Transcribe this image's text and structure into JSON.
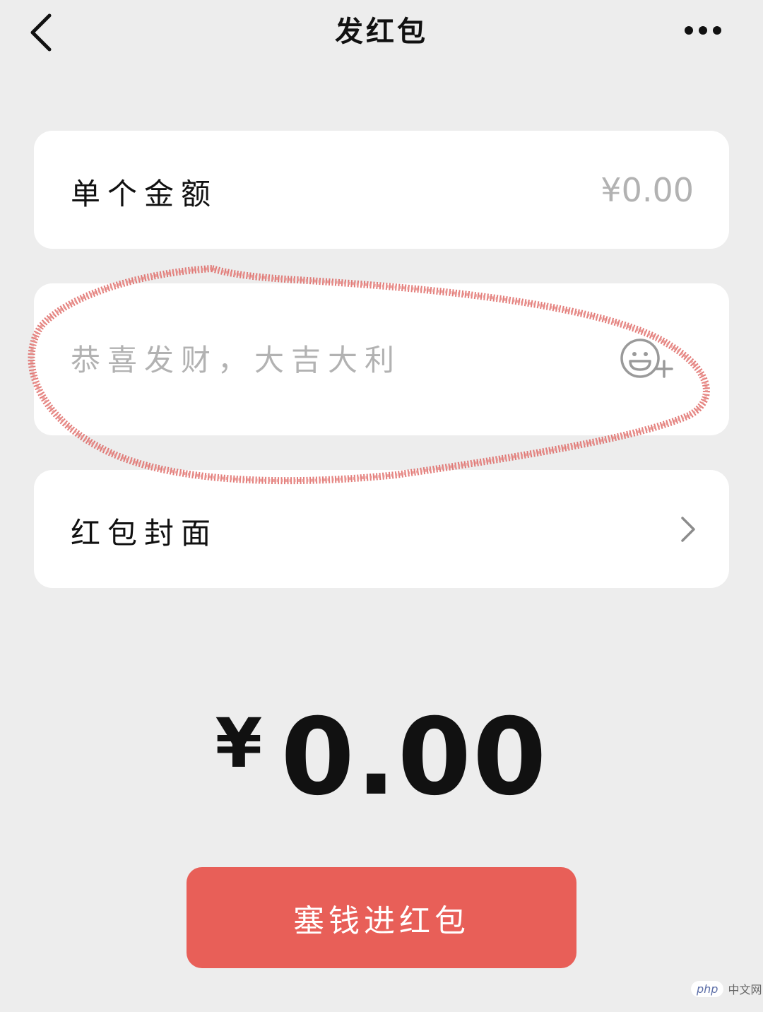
{
  "header": {
    "title": "发红包",
    "back_icon": "chevron-left-icon",
    "more_icon": "more-horizontal-icon"
  },
  "amount_row": {
    "label": "单个金额",
    "placeholder": "¥0.00"
  },
  "greeting_row": {
    "placeholder": "恭喜发财，大吉大利",
    "emoji_icon": "emoji-add-icon"
  },
  "cover_row": {
    "label": "红包封面",
    "chevron_icon": "chevron-right-icon"
  },
  "total": {
    "currency": "¥",
    "value": "0.00"
  },
  "submit": {
    "label": "塞钱进红包"
  },
  "watermark": {
    "logo": "php",
    "text": "中文网"
  },
  "colors": {
    "background": "#ededed",
    "card": "#ffffff",
    "accent_button": "#e85f58",
    "placeholder_text": "#b2b2b2",
    "annotation_stroke": "#d9534f"
  }
}
